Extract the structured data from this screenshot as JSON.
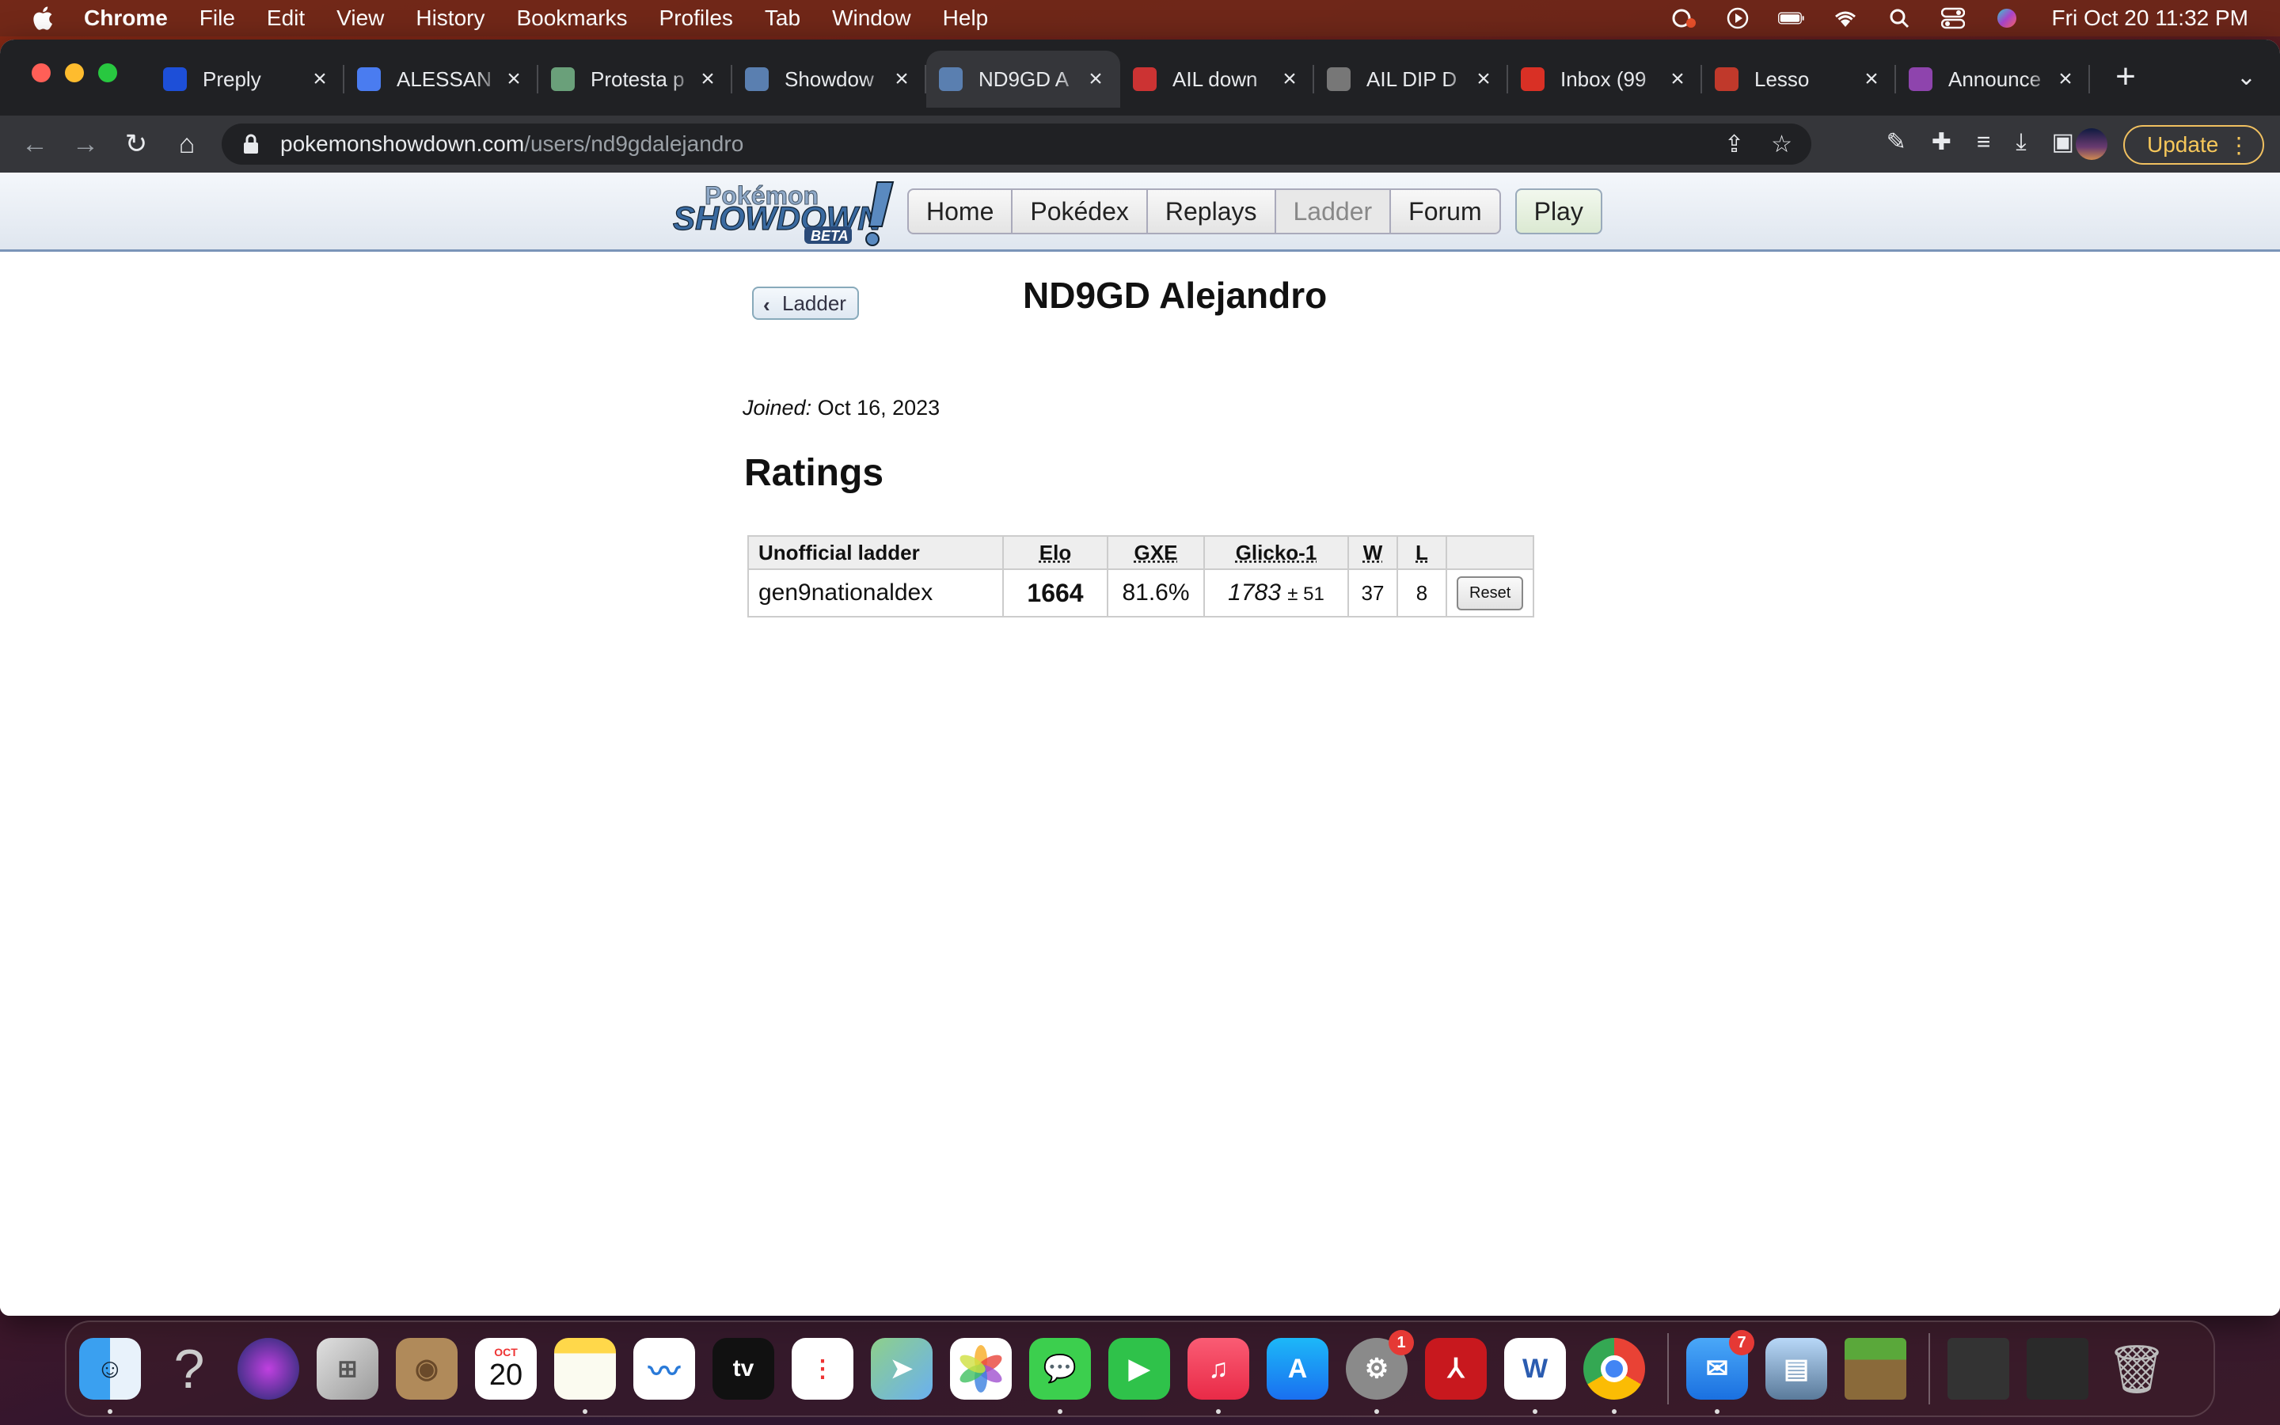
{
  "menubar": {
    "app": "Chrome",
    "items": [
      "File",
      "Edit",
      "View",
      "History",
      "Bookmarks",
      "Profiles",
      "Tab",
      "Window",
      "Help"
    ],
    "clock": "Fri Oct 20  11:32 PM"
  },
  "tabs": [
    {
      "title": "Preply",
      "color": "#1d4fd8"
    },
    {
      "title": "ALESSAN",
      "color": "#4a7cf0"
    },
    {
      "title": "Protesta p",
      "color": "#6aa07a"
    },
    {
      "title": "Showdow",
      "color": "#5a7fb0"
    },
    {
      "title": "ND9GD A",
      "color": "#5a7fb0",
      "active": true
    },
    {
      "title": "AIL down",
      "color": "#cc3333"
    },
    {
      "title": "AIL DIP D",
      "color": "#777777"
    },
    {
      "title": "Inbox (99",
      "color": "#d93025"
    },
    {
      "title": "Lesso",
      "color": "#c0392b"
    },
    {
      "title": "Announce",
      "color": "#8e44ad"
    }
  ],
  "address": {
    "host": "pokemonshowdown.com",
    "path": "/users/nd9gdalejandro"
  },
  "update_label": "Update",
  "site": {
    "logo_top": "Pokémon",
    "logo_main": "SHOWDOWN",
    "logo_beta": "BETA",
    "nav": [
      "Home",
      "Pokédex",
      "Replays",
      "Ladder",
      "Forum"
    ],
    "play": "Play"
  },
  "page": {
    "back_label": "Ladder",
    "username": "ND9GD Alejandro",
    "joined_label": "Joined:",
    "joined_date": "Oct 16, 2023",
    "ratings_heading": "Ratings",
    "table": {
      "headers": [
        "Unofficial ladder",
        "Elo",
        "GXE",
        "Glicko-1",
        "W",
        "L"
      ],
      "row": {
        "format": "gen9nationaldex",
        "elo": "1664",
        "gxe": "81.6%",
        "glicko": "1783",
        "glicko_dev": "± 51",
        "wins": "37",
        "losses": "8",
        "reset_label": "Reset"
      }
    }
  },
  "dock": {
    "calendar_month": "OCT",
    "calendar_day": "20",
    "settings_badge": "1",
    "mail_badge": "7"
  }
}
